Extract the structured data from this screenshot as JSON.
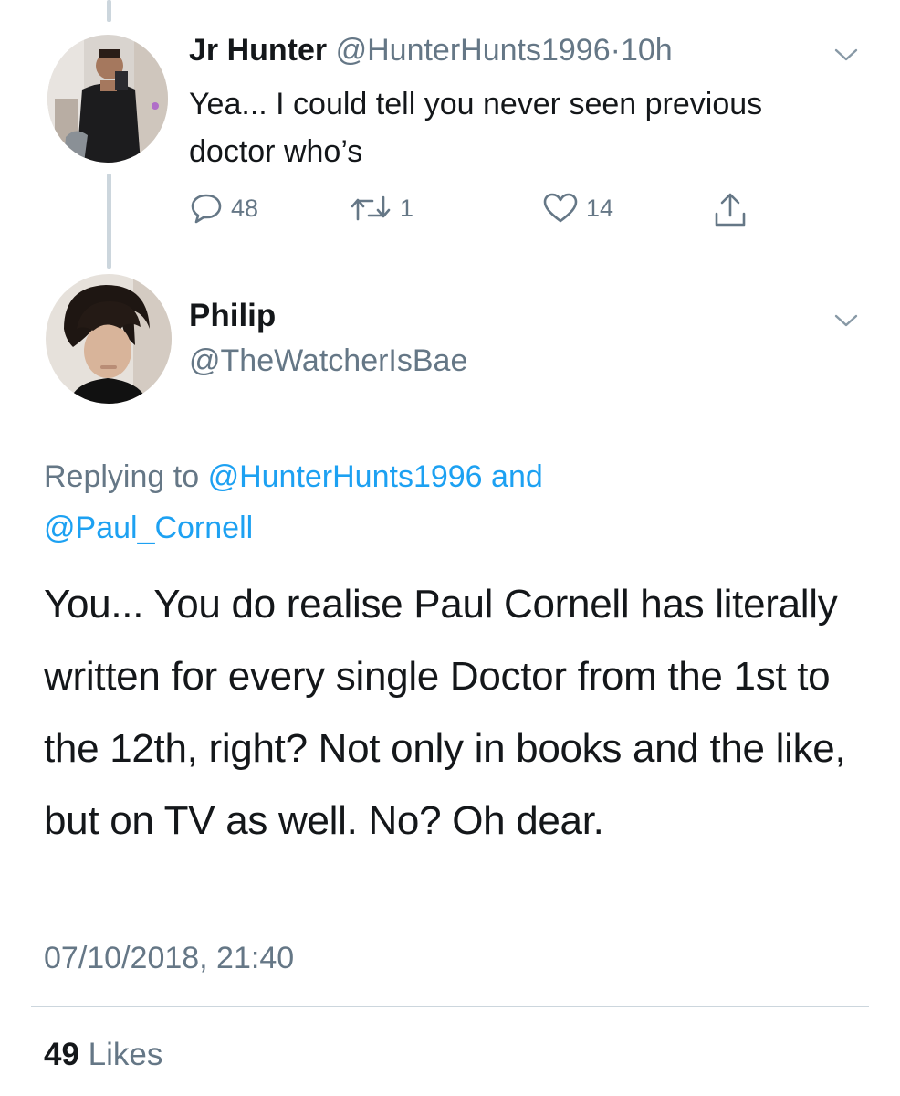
{
  "tweet_1": {
    "name": "Jr Hunter",
    "handle": "@HunterHunts1996",
    "separator": "·",
    "time": "10h",
    "text": "Yea... I could tell you never seen previous doctor who’s",
    "reply_count": "48",
    "retweet_count": "1",
    "like_count": "14",
    "icons": [
      "reply-icon",
      "retweet-icon",
      "heart-icon",
      "share-icon",
      "chevron-down-icon"
    ]
  },
  "tweet_2": {
    "name": "Philip",
    "handle": "@TheWatcherIsBae",
    "replying_prefix": "Replying to",
    "replying_to_1": "@HunterHunts1996",
    "replying_and": "and",
    "replying_to_2": "@Paul_Cornell",
    "text": "You... You do realise Paul Cornell has literally written for every single Doctor from the 1st to the 12th, right? Not only in books and the like, but on TV as well. No? Oh dear.",
    "timestamp": "07/10/2018, 21:40",
    "likes_count": "49",
    "likes_label": "Likes"
  },
  "colors": {
    "text": "#14171a",
    "secondary": "#657786",
    "link": "#1da1f2",
    "line": "#ccd6dd"
  }
}
